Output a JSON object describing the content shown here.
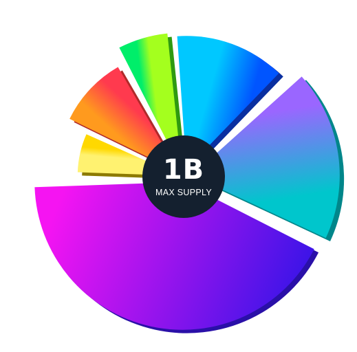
{
  "chart_data": {
    "type": "pie",
    "style": "exploded 3d donut, slices of varying radius",
    "center": {
      "value": "1B",
      "label": "MAX SUPPLY",
      "color": "#14202f"
    },
    "slices": [
      {
        "start": 356,
        "end": 44,
        "radius_scale": 0.9,
        "explode": 12,
        "colors": [
          "#00c8ff",
          "#0055ff"
        ],
        "side": "#0a2fa0"
      },
      {
        "start": 48,
        "end": 115,
        "radius_scale": 1.0,
        "explode": 12,
        "colors": [
          "#9a66ff",
          "#00c6cc"
        ],
        "side": "#00868a"
      },
      {
        "start": 117,
        "end": 268,
        "radius_scale": 1.0,
        "explode": 8,
        "colors": [
          "#3b14e8",
          "#f514f2"
        ],
        "side": "#2a10a8"
      },
      {
        "start": 272,
        "end": 294,
        "radius_scale": 0.69,
        "explode": 6,
        "colors": [
          "#fff270",
          "#ffd800"
        ],
        "side": "#8c7a00"
      },
      {
        "start": 296,
        "end": 330,
        "radius_scale": 0.82,
        "explode": 10,
        "colors": [
          "#ff9a1e",
          "#ff3a4e"
        ],
        "side": "#b02a2a"
      },
      {
        "start": 333,
        "end": 354,
        "radius_scale": 0.93,
        "explode": 10,
        "colors": [
          "#00ee6a",
          "#a4ff1e"
        ],
        "side": "#2f9a10"
      }
    ]
  }
}
